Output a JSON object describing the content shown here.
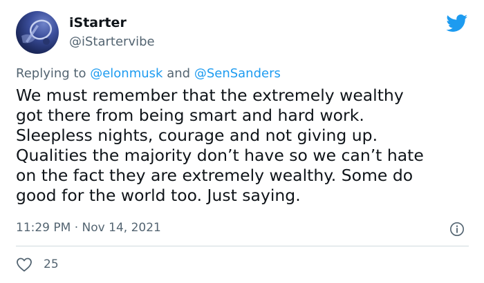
{
  "tweet": {
    "author": {
      "name": "iStarter",
      "handle": "@iStartervibe"
    },
    "reply": {
      "prefix": "Replying to",
      "mention_1": "@elonmusk",
      "conjunction": "and",
      "mention_2": "@SenSanders"
    },
    "text_lines": [
      "We must remember that the extremely wealthy",
      "got there from being smart and hard work.",
      "Sleepless nights, courage and not giving up.",
      "Qualities the majority don’t have so we can’t hate",
      "on the fact they are extremely wealthy. Some do",
      "good for the world too. Just saying."
    ],
    "time": "11:29 PM",
    "separator": "·",
    "date": "Nov 14, 2021",
    "like_count": "25"
  },
  "icons": {
    "logo": "twitter-bird-icon",
    "info": "info-icon",
    "like": "heart-icon"
  },
  "colors": {
    "brand": "#1d9bf0",
    "text": "#0f1419",
    "secondary": "#536471",
    "divider": "#cfd9de"
  }
}
